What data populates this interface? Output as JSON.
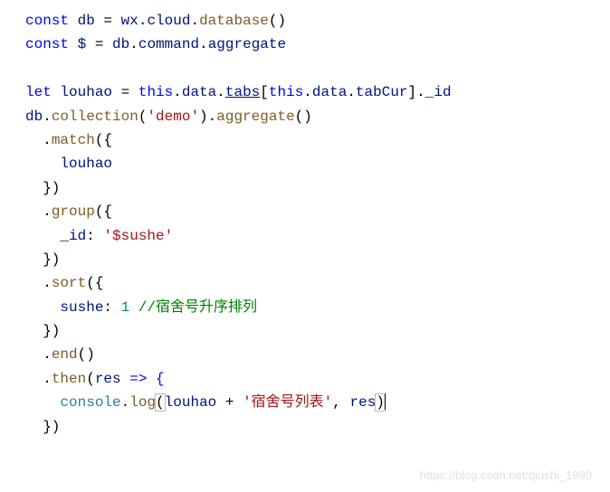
{
  "lines": {
    "l1_const": "const",
    "l1_db": "db",
    "l1_eq": " = ",
    "l1_wx": "wx",
    "l1_dot1": ".",
    "l1_cloud": "cloud",
    "l1_dot2": ".",
    "l1_database": "database",
    "l1_paren": "()",
    "l2_const": "const",
    "l2_dollar": "$",
    "l2_eq": " = ",
    "l2_db": "db",
    "l2_dot1": ".",
    "l2_command": "command",
    "l2_dot2": ".",
    "l2_aggregate": "aggregate",
    "l4_let": "let",
    "l4_louhao": "louhao",
    "l4_eq": " = ",
    "l4_this1": "this",
    "l4_dot1": ".",
    "l4_data1": "data",
    "l4_dot2": ".",
    "l4_tabs": "tabs",
    "l4_lb": "[",
    "l4_this2": "this",
    "l4_dot3": ".",
    "l4_data2": "data",
    "l4_dot4": ".",
    "l4_tabcur": "tabCur",
    "l4_rb": "].",
    "l4_id": "_id",
    "l5_db": "db",
    "l5_dot1": ".",
    "l5_collection": "collection",
    "l5_lp": "(",
    "l5_demo": "'demo'",
    "l5_rp": ").",
    "l5_aggregate": "aggregate",
    "l5_paren": "()",
    "l6_dot": "  .",
    "l6_match": "match",
    "l6_open": "({",
    "l7_louhao": "    louhao",
    "l8_close": "  })",
    "l9_dot": "  .",
    "l9_group": "group",
    "l9_open": "({",
    "l10_id": "    _id",
    "l10_colon": ": ",
    "l10_sushe": "'$sushe'",
    "l11_close": "  })",
    "l12_dot": "  .",
    "l12_sort": "sort",
    "l12_open": "({",
    "l13_sushe": "    sushe",
    "l13_colon": ": ",
    "l13_one": "1",
    "l13_sp": " ",
    "l13_comment": "//宿舍号升序排列",
    "l14_close": "  })",
    "l15_dot": "  .",
    "l15_end": "end",
    "l15_paren": "()",
    "l16_dot": "  .",
    "l16_then": "then",
    "l16_lp": "(",
    "l16_res": "res",
    "l16_arrow": " => {",
    "l17_indent": "    ",
    "l17_console": "console",
    "l17_dot": ".",
    "l17_log": "log",
    "l17_lp": "(",
    "l17_louhao": "louhao",
    "l17_plus": " + ",
    "l17_str": "'宿舍号列表'",
    "l17_comma": ", ",
    "l17_res": "res",
    "l17_rp": ")",
    "l18_close": "  })"
  },
  "watermark": "https://blog.csdn.net/qiushi_1990"
}
